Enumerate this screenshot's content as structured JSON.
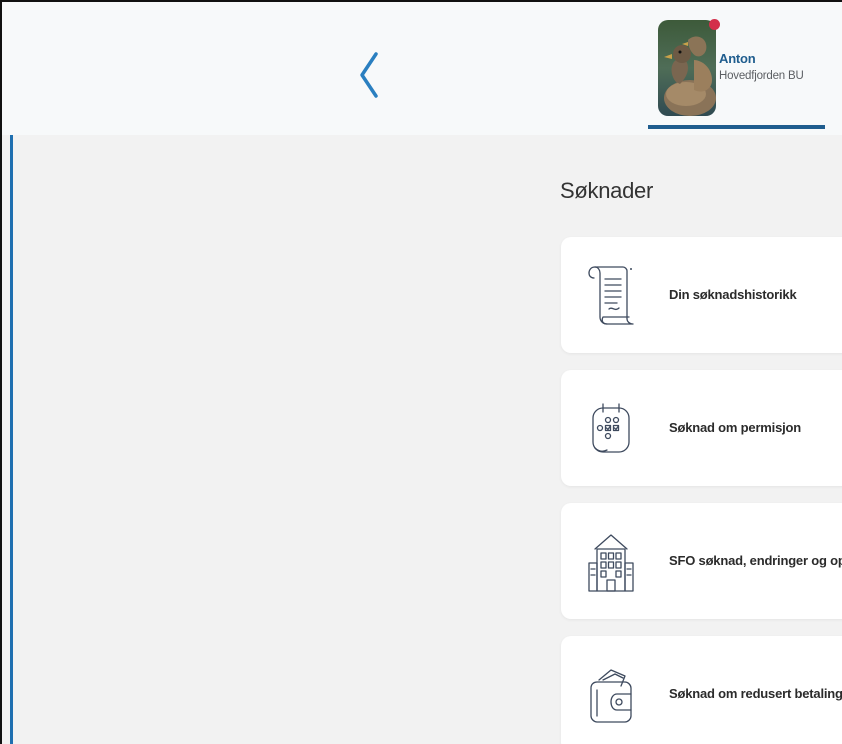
{
  "header": {
    "back_icon": "chevron-left-icon",
    "profile": {
      "name": "Anton",
      "unit": "Hovedfjorden BU",
      "has_notification": true
    }
  },
  "main": {
    "title": "Søknader",
    "cards": [
      {
        "label": "Din søknadshistorikk",
        "icon": "scroll-icon"
      },
      {
        "label": "Søknad om permisjon",
        "icon": "calendar-icon"
      },
      {
        "label": "SFO søknad, endringer og op",
        "icon": "school-building-icon"
      },
      {
        "label": "Søknad om redusert betaling",
        "icon": "wallet-icon"
      }
    ]
  },
  "colors": {
    "accent": "#1f6fb0",
    "name_blue": "#1f5d8e",
    "notification": "#d32f4b",
    "content_bg": "#f2f2f2",
    "header_bg": "#f7f9fa"
  }
}
